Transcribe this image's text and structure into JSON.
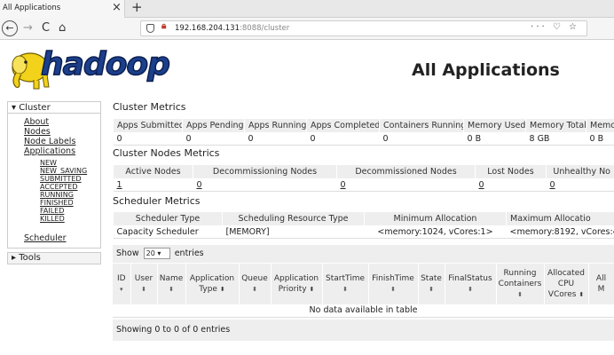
{
  "browser": {
    "tab_title": "All Applications",
    "tab_close": "×",
    "new_tab": "+",
    "back": "←",
    "forward": "→",
    "reload": "C",
    "home": "⌂",
    "url_host": "192.168.204.131",
    "url_path": ":8088/cluster",
    "page_actions": "··· ♡ ☆"
  },
  "header": {
    "logo_text": "hadoop",
    "title": "All Applications"
  },
  "nav": {
    "cluster_label": "Cluster",
    "about": "About",
    "nodes": "Nodes",
    "node_labels": "Node Labels",
    "applications": "Applications",
    "app_states": [
      "NEW",
      "NEW_SAVING",
      "SUBMITTED",
      "ACCEPTED",
      "RUNNING",
      "FINISHED",
      "FAILED",
      "KILLED"
    ],
    "scheduler": "Scheduler",
    "tools_label": "Tools"
  },
  "cluster_metrics": {
    "title": "Cluster Metrics",
    "headers": [
      "Apps Submitted",
      "Apps Pending",
      "Apps Running",
      "Apps Completed",
      "Containers Running",
      "Memory Used",
      "Memory Total",
      "Memo"
    ],
    "values": [
      "0",
      "0",
      "0",
      "0",
      "0",
      "0 B",
      "8 GB",
      "0 B"
    ]
  },
  "node_metrics": {
    "title": "Cluster Nodes Metrics",
    "headers": [
      "Active Nodes",
      "Decommissioning Nodes",
      "Decommissioned Nodes",
      "Lost Nodes",
      "Unhealthy No"
    ],
    "values": [
      "1",
      "0",
      "0",
      "0",
      "0"
    ]
  },
  "scheduler_metrics": {
    "title": "Scheduler Metrics",
    "headers": [
      "Scheduler Type",
      "Scheduling Resource Type",
      "Minimum Allocation",
      "Maximum Allocatio"
    ],
    "values": [
      "Capacity Scheduler",
      "[MEMORY]",
      "<memory:1024, vCores:1>",
      "<memory:8192, vCores:4>"
    ]
  },
  "apps_table": {
    "show_label": "Show",
    "show_value": "20",
    "entries_label": "entries",
    "headers": [
      {
        "l1": "ID",
        "l2": ""
      },
      {
        "l1": "User",
        "l2": ""
      },
      {
        "l1": "Name",
        "l2": ""
      },
      {
        "l1": "Application",
        "l2": "Type"
      },
      {
        "l1": "Queue",
        "l2": ""
      },
      {
        "l1": "Application",
        "l2": "Priority"
      },
      {
        "l1": "StartTime",
        "l2": ""
      },
      {
        "l1": "FinishTime",
        "l2": ""
      },
      {
        "l1": "State",
        "l2": ""
      },
      {
        "l1": "FinalStatus",
        "l2": ""
      },
      {
        "l1": "Running",
        "l2": "Containers"
      },
      {
        "l1": "Allocated",
        "l2": "CPU VCores"
      },
      {
        "l1": "All",
        "l2": "M"
      }
    ],
    "empty_message": "No data available in table",
    "info": "Showing 0 to 0 of 0 entries"
  }
}
